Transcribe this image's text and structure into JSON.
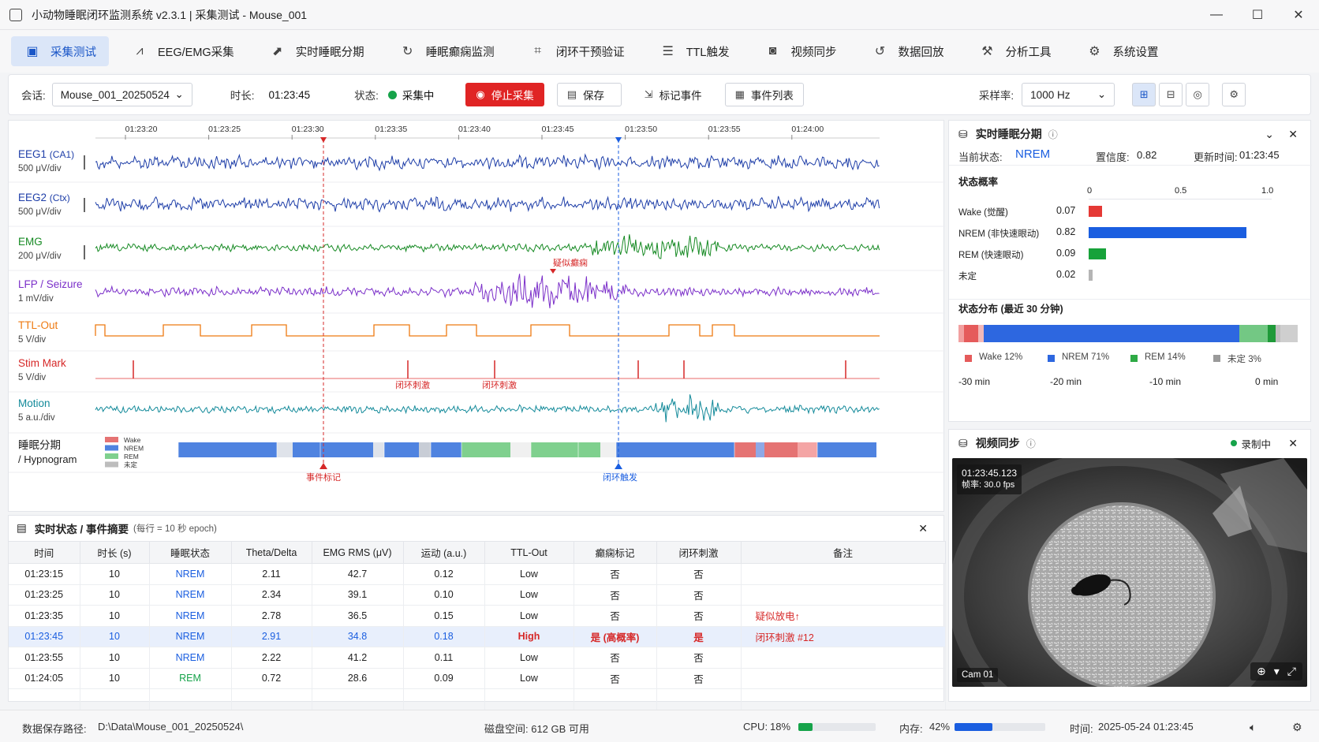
{
  "window": {
    "title": "小动物睡眠闭环监测系统 v2.3.1  |  采集测试 - Mouse_001",
    "minimize": "—",
    "maximize": "☐",
    "close": "✕"
  },
  "menu": [
    {
      "label": "采集测试",
      "icon": "monitor-icon"
    },
    {
      "label": "EEG/EMG采集",
      "icon": "waveform-icon"
    },
    {
      "label": "实时睡眠分期",
      "icon": "chart-icon"
    },
    {
      "label": "睡眠癫痫监测",
      "icon": "loop-icon"
    },
    {
      "label": "闭环干预验证",
      "icon": "network-icon"
    },
    {
      "label": "TTL触发",
      "icon": "sliders-icon"
    },
    {
      "label": "视频同步",
      "icon": "camera-icon"
    },
    {
      "label": "数据回放",
      "icon": "history-icon"
    },
    {
      "label": "分析工具",
      "icon": "tools-icon"
    },
    {
      "label": "系统设置",
      "icon": "gear-icon"
    }
  ],
  "toolbar": {
    "session_label": "会话:",
    "session_value": "Mouse_001_20250524",
    "duration_label": "时长:",
    "duration_value": "01:23:45",
    "status_label": "状态:",
    "status_value": "采集中",
    "stop_label": "停止采集",
    "save_label": "保存",
    "mark_label": "标记事件",
    "events_label": "事件列表",
    "rate_label": "采样率:",
    "rate_value": "1000 Hz"
  },
  "signals": {
    "time_ticks": [
      "01:23:20",
      "01:23:25",
      "01:23:30",
      "01:23:35",
      "01:23:40",
      "01:23:45",
      "01:23:50",
      "01:23:55",
      "01:24:00"
    ],
    "channels": [
      {
        "name": "EEG1",
        "sub": "(CA1)",
        "unit": "500 μV/div",
        "color": "#1e3ea8"
      },
      {
        "name": "EEG2",
        "sub": "(Ctx)",
        "unit": "500 μV/div",
        "color": "#1e3ea8"
      },
      {
        "name": "EMG",
        "sub": "",
        "unit": "200 μV/div",
        "color": "#168a23"
      },
      {
        "name": "LFP / Seizure",
        "sub": "",
        "unit": "1 mV/div",
        "color": "#7b2fc9"
      },
      {
        "name": "TTL-Out",
        "sub": "",
        "unit": "5 V/div",
        "color": "#ee7a12"
      },
      {
        "name": "Stim Mark",
        "sub": "",
        "unit": "5 V/div",
        "color": "#d62828"
      },
      {
        "name": "Motion",
        "sub": "",
        "unit": "5 a.u./div",
        "color": "#138a9a"
      }
    ],
    "hypnogram_label": "睡眠分期",
    "hypnogram_label2": "/ Hypnogram",
    "legend": [
      "Wake",
      "NREM",
      "REM",
      "未定"
    ],
    "annotations": {
      "seizure": "疑似癫痫",
      "stim1": "闭环刺激",
      "stim2": "闭环刺激",
      "event_mark": "事件标记",
      "loop_trigger": "闭环触发"
    }
  },
  "events": {
    "title": "实时状态 / 事件摘要",
    "subtitle": "(每行 = 10 秒 epoch)",
    "columns": [
      "时间",
      "时长 (s)",
      "睡眠状态",
      "Theta/Delta",
      "EMG RMS (μV)",
      "运动 (a.u.)",
      "TTL-Out",
      "癫痫标记",
      "闭环刺激",
      "备注"
    ],
    "rows": [
      [
        "01:23:15",
        "10",
        "NREM",
        "2.11",
        "42.7",
        "0.12",
        "Low",
        "否",
        "否",
        ""
      ],
      [
        "01:23:25",
        "10",
        "NREM",
        "2.34",
        "39.1",
        "0.10",
        "Low",
        "否",
        "否",
        ""
      ],
      [
        "01:23:35",
        "10",
        "NREM",
        "2.78",
        "36.5",
        "0.15",
        "Low",
        "否",
        "否",
        "疑似放电↑"
      ],
      [
        "01:23:45",
        "10",
        "NREM",
        "2.91",
        "34.8",
        "0.18",
        "High",
        "是 (高概率)",
        "是",
        "闭环刺激 #12"
      ],
      [
        "01:23:55",
        "10",
        "NREM",
        "2.22",
        "41.2",
        "0.11",
        "Low",
        "否",
        "否",
        ""
      ],
      [
        "01:24:05",
        "10",
        "REM",
        "0.72",
        "28.6",
        "0.09",
        "Low",
        "否",
        "否",
        ""
      ]
    ]
  },
  "staging": {
    "title": "实时睡眠分期",
    "current_label": "当前状态:",
    "current_value": "NREM",
    "confidence_label": "置信度:",
    "confidence_value": "0.82",
    "update_label": "更新时间:",
    "update_value": "01:23:45",
    "prob_title": "状态概率",
    "axis": [
      "0",
      "0.5",
      "1.0"
    ],
    "probs": [
      {
        "label": "Wake (觉醒)",
        "value": "0.07",
        "p": 0.07,
        "color": "#e53935"
      },
      {
        "label": "NREM (非快速眼动)",
        "value": "0.82",
        "p": 0.82,
        "color": "#1a5ee0"
      },
      {
        "label": "REM (快速眼动)",
        "value": "0.09",
        "p": 0.09,
        "color": "#17a23a"
      },
      {
        "label": "未定",
        "value": "0.02",
        "p": 0.02,
        "color": "#b5b5b5"
      }
    ],
    "dist_title": "状态分布 (最近 30 分钟)",
    "dist_legend": [
      {
        "label": "Wake 12%",
        "color": "#e55b5b"
      },
      {
        "label": "NREM 71%",
        "color": "#2d67e0"
      },
      {
        "label": "REM 14%",
        "color": "#2eaa45"
      },
      {
        "label": "未定 3%",
        "color": "#9a9a9a"
      }
    ],
    "dist_axis": [
      "-30 min",
      "-20 min",
      "-10 min",
      "0 min"
    ]
  },
  "video": {
    "title": "视频同步",
    "status": "录制中",
    "timestamp": "01:23:45.123",
    "fps": "帧率: 30.0 fps",
    "cam": "Cam 01"
  },
  "status": {
    "path_label": "数据保存路径:",
    "path_value": "D:\\Data\\Mouse_001_20250524\\",
    "disk": "磁盘空间:  612 GB 可用",
    "cpu_label": "CPU:",
    "cpu_value": "18%",
    "cpu": 0.18,
    "mem_label": "内存:",
    "mem_value": "42%",
    "mem": 0.42,
    "time_label": "时间:",
    "time_value": "2025-05-24  01:23:45"
  }
}
